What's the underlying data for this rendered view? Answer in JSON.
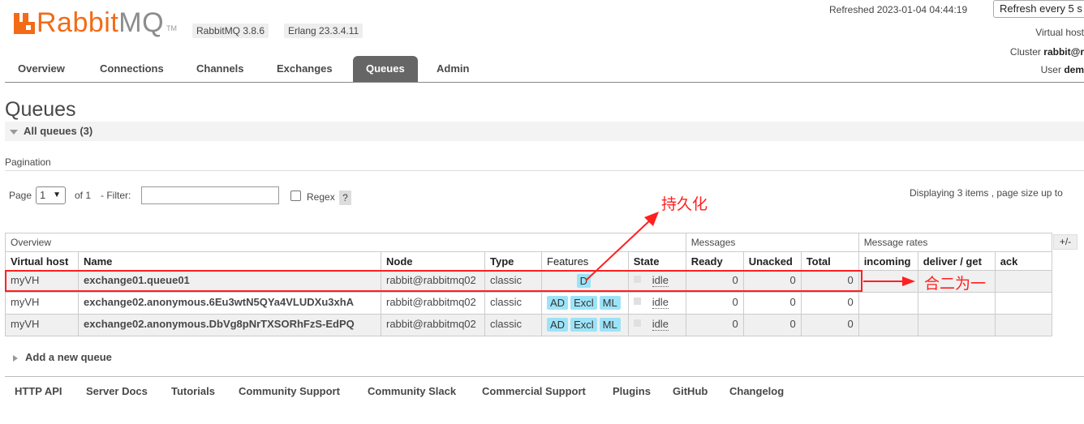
{
  "header": {
    "logo_orange": "Rabbit",
    "logo_gray": "MQ",
    "logo_tm": "TM",
    "rabbitmq_version": "RabbitMQ 3.8.6",
    "erlang_version": "Erlang 23.3.4.11",
    "refreshed": "Refreshed 2023-01-04 04:44:19",
    "refresh_select": "Refresh every 5 s",
    "virtual_host_label": "Virtual host",
    "cluster_label": "Cluster",
    "cluster_value": "rabbit@r",
    "user_label": "User",
    "user_value": "dem"
  },
  "nav": {
    "tabs": [
      "Overview",
      "Connections",
      "Channels",
      "Exchanges",
      "Queues",
      "Admin"
    ],
    "active": "Queues"
  },
  "page": {
    "title": "Queues",
    "section_label": "All queues (3)",
    "pagination_label": "Pagination",
    "page_label": "Page",
    "page_value": "1",
    "of_label": "of 1",
    "filter_label": "- Filter:",
    "filter_value": "",
    "regex_label": "Regex",
    "help_label": "?",
    "displaying": "Displaying 3 items , page size up to"
  },
  "table": {
    "group_headers": {
      "overview": "Overview",
      "messages": "Messages",
      "message_rates": "Message rates"
    },
    "plus_minus": "+/-",
    "columns": [
      "Virtual host",
      "Name",
      "Node",
      "Type",
      "Features",
      "State",
      "Ready",
      "Unacked",
      "Total",
      "incoming",
      "deliver / get",
      "ack"
    ],
    "rows": [
      {
        "vhost": "myVH",
        "name": "exchange01.queue01",
        "node": "rabbit@rabbitmq02",
        "type": "classic",
        "features": [
          "D"
        ],
        "state": "idle",
        "ready": "0",
        "unacked": "0",
        "total": "0"
      },
      {
        "vhost": "myVH",
        "name": "exchange02.anonymous.6Eu3wtN5QYa4VLUDXu3xhA",
        "node": "rabbit@rabbitmq02",
        "type": "classic",
        "features": [
          "AD",
          "Excl",
          "ML"
        ],
        "state": "idle",
        "ready": "0",
        "unacked": "0",
        "total": "0"
      },
      {
        "vhost": "myVH",
        "name": "exchange02.anonymous.DbVg8pNrTXSORhFzS-EdPQ",
        "node": "rabbit@rabbitmq02",
        "type": "classic",
        "features": [
          "AD",
          "Excl",
          "ML"
        ],
        "state": "idle",
        "ready": "0",
        "unacked": "0",
        "total": "0"
      }
    ]
  },
  "add_queue": "Add a new queue",
  "footer": {
    "links": [
      "HTTP API",
      "Server Docs",
      "Tutorials",
      "Community Support",
      "Community Slack",
      "Commercial Support",
      "Plugins",
      "GitHub",
      "Changelog"
    ]
  },
  "annotations": {
    "persistent": "持久化",
    "merge": "合二为一",
    "color": "#ff2020"
  },
  "colors": {
    "brand_orange": "#f36b17",
    "active_tab": "#666666",
    "feature_badge": "#9de3f7"
  }
}
